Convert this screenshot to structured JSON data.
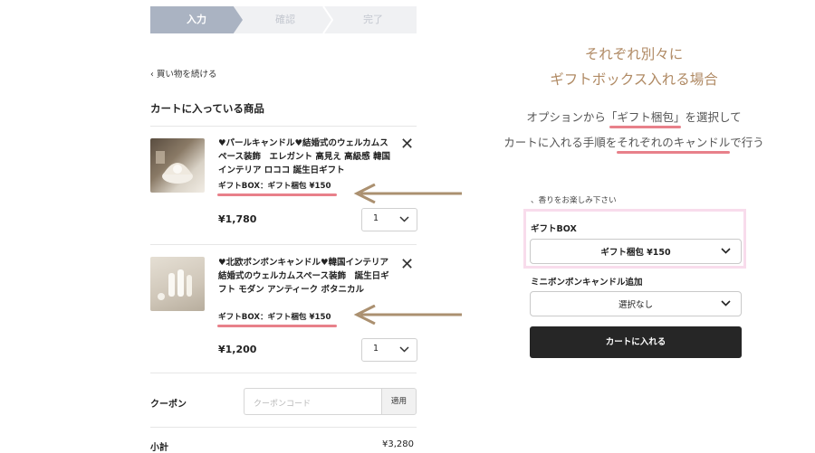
{
  "steps": [
    "入力",
    "確認",
    "完了"
  ],
  "back_link": "買い物を続ける",
  "cart_title": "カートに入っている商品",
  "items": [
    {
      "name": "♥パールキャンドル♥結婚式のウェルカムスペース装飾　エレガント 高見え 高級感 韓国インテリア ロココ 誕生日ギフト",
      "option": "ギフトBOX：ギフト梱包 ¥150",
      "price": "¥1,780",
      "qty": "1",
      "thumb_text": "pearl"
    },
    {
      "name": "♥北欧ボンボンキャンドル♥韓国インテリア　結婚式のウェルカムスペース装飾　誕生日ギフト モダン アンティーク ボタニカル",
      "option": "ギフトBOX：ギフト梱包 ¥150",
      "price": "¥1,200",
      "qty": "1",
      "thumb_text": "Bonbon candle"
    }
  ],
  "coupon": {
    "label": "クーポン",
    "placeholder": "クーポンコード",
    "apply": "適用"
  },
  "subtotal": {
    "label": "小計",
    "value": "¥3,280"
  },
  "caption": {
    "line1": "それぞれ別々に",
    "line2": "ギフトボックス入れる場合",
    "line3_pre": "オプションから",
    "line3_hl": "「ギフト梱包」",
    "line3_post": "を選択して",
    "line4_pre": "カートに入れる手順を",
    "line4_hl": "それぞれのキャンドル",
    "line4_post": "で行う"
  },
  "form": {
    "fragrance_note": "、香りをお楽しみ下さい",
    "gift_label": "ギフトBOX",
    "gift_value": "ギフト梱包 ¥150",
    "mini_label": "ミニボンボンキャンドル追加",
    "mini_value": "選択なし",
    "cart_button": "カートに入れる"
  },
  "colors": {
    "accent_caption": "#b08a64",
    "highlight": "#e8808a",
    "arrow": "#ab9070",
    "pink_box": "#f8dcec",
    "step_active": "#aab3c2"
  }
}
